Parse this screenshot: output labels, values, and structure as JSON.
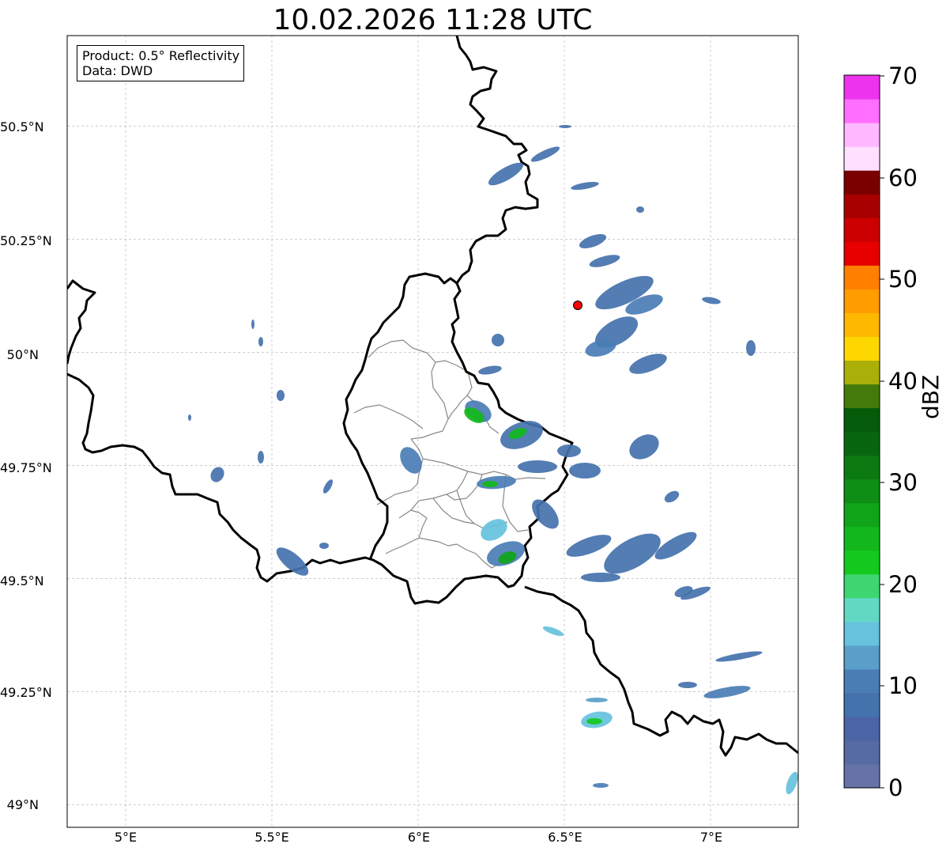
{
  "title": "10.02.2026 11:28 UTC",
  "info_box": {
    "product": "Product: 0.5° Reflectivity",
    "data_source": "Data: DWD"
  },
  "map": {
    "longitude_range": [
      4.8,
      7.3
    ],
    "latitude_range": [
      48.95,
      50.7
    ],
    "gridlines": true,
    "lat_ticks": [
      {
        "value": 50.5,
        "label": "50.5°N"
      },
      {
        "value": 50.25,
        "label": "50.25°N"
      },
      {
        "value": 50.0,
        "label": "50°N"
      },
      {
        "value": 49.75,
        "label": "49.75°N"
      },
      {
        "value": 49.5,
        "label": "49.5°N"
      },
      {
        "value": 49.25,
        "label": "49.25°N"
      },
      {
        "value": 49.0,
        "label": "49°N"
      }
    ],
    "lon_ticks": [
      {
        "value": 5.0,
        "label": "5°E"
      },
      {
        "value": 5.5,
        "label": "5.5°E"
      },
      {
        "value": 6.0,
        "label": "6°E"
      },
      {
        "value": 6.5,
        "label": "6.5°E"
      },
      {
        "value": 7.0,
        "label": "7°E"
      }
    ],
    "radar_site_color": "#ff0000"
  },
  "colorbar": {
    "title": "dBZ",
    "min": 0,
    "max": 70,
    "ticks": [
      {
        "value": 0,
        "label": "0"
      },
      {
        "value": 10,
        "label": "10"
      },
      {
        "value": 20,
        "label": "20"
      },
      {
        "value": 30,
        "label": "30"
      },
      {
        "value": 40,
        "label": "40"
      },
      {
        "value": 50,
        "label": "50"
      },
      {
        "value": 60,
        "label": "60"
      },
      {
        "value": 70,
        "label": "70"
      }
    ],
    "colors": [
      "#6673a6",
      "#566aa3",
      "#4a64a6",
      "#4472ad",
      "#4b7db5",
      "#5a9fca",
      "#66c2dd",
      "#62d8c3",
      "#3dd671",
      "#14c91e",
      "#12b81b",
      "#10a418",
      "#0f8e15",
      "#0b7a11",
      "#096610",
      "#045b09",
      "#447a0a",
      "#aab007",
      "#ffd700",
      "#ffb800",
      "#ff9c00",
      "#ff7f00",
      "#e60000",
      "#cc0000",
      "#a80000",
      "#7a0000",
      "#ffe0ff",
      "#ffb8ff",
      "#ff6eff",
      "#ee33ee"
    ]
  }
}
